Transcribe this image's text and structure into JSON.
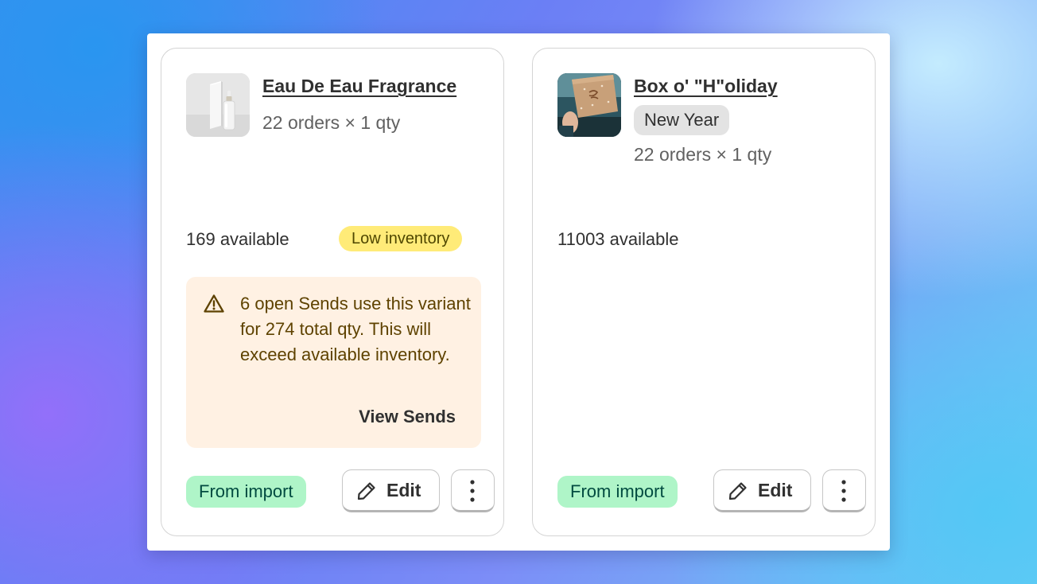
{
  "cards": [
    {
      "product_name": "Eau De Eau Fragrance",
      "thumbnail": "fragrance-bottle-image",
      "orders": "22 orders × 1 qty",
      "available": "169 available",
      "inventory_badge": "Low inventory",
      "warning": {
        "icon": "alert-triangle-icon",
        "message": "6 open Sends use this variant for 274 total qty. This will exceed available inventory.",
        "action_label": "View Sends"
      },
      "source_badge": "From import",
      "edit_label": "Edit",
      "edit_icon": "pencil-icon",
      "more_icon": "more-vertical-icon"
    },
    {
      "product_name": "Box o' \"H\"oliday",
      "thumbnail": "holiday-box-image",
      "tag": "New Year",
      "orders": "22 orders × 1 qty",
      "available": "11003 available",
      "source_badge": "From import",
      "edit_label": "Edit",
      "edit_icon": "pencil-icon",
      "more_icon": "more-vertical-icon"
    }
  ],
  "colors": {
    "low_inventory_badge": "#ffeb78",
    "warning_banner": "#fff1e3",
    "warning_text": "#5e4200",
    "import_badge": "#aff5c8",
    "tag_background": "#e3e3e3",
    "title_text": "#303030"
  }
}
